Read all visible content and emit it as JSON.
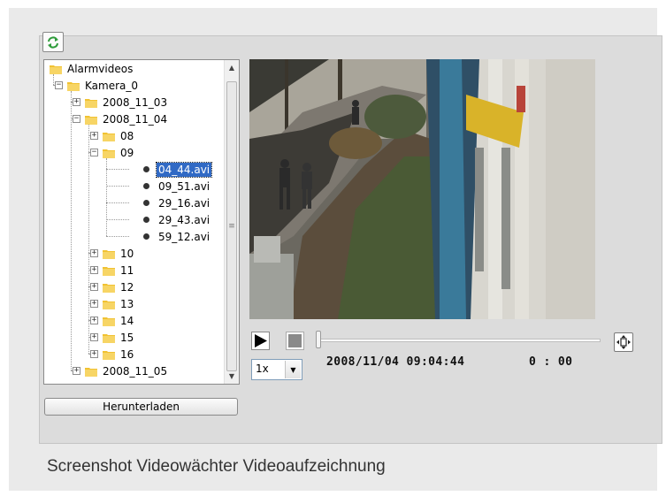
{
  "tree": {
    "items": [
      {
        "label": "Alarmvideos",
        "kind": "folder",
        "level": 0
      },
      {
        "label": "Kamera_0",
        "kind": "folder",
        "level": 1,
        "expanded": true
      },
      {
        "label": "2008_11_03",
        "kind": "folder",
        "level": 2,
        "expanded": false
      },
      {
        "label": "2008_11_04",
        "kind": "folder",
        "level": 2,
        "expanded": true
      },
      {
        "label": "08",
        "kind": "folder",
        "level": 3,
        "expanded": false
      },
      {
        "label": "09",
        "kind": "folder",
        "level": 3,
        "expanded": true
      },
      {
        "label": "04_44.avi",
        "kind": "file",
        "level": 4,
        "selected": true
      },
      {
        "label": "09_51.avi",
        "kind": "file",
        "level": 4
      },
      {
        "label": "29_16.avi",
        "kind": "file",
        "level": 4
      },
      {
        "label": "29_43.avi",
        "kind": "file",
        "level": 4
      },
      {
        "label": "59_12.avi",
        "kind": "file",
        "level": 4
      },
      {
        "label": "10",
        "kind": "folder",
        "level": 3,
        "expanded": false
      },
      {
        "label": "11",
        "kind": "folder",
        "level": 3,
        "expanded": false
      },
      {
        "label": "12",
        "kind": "folder",
        "level": 3,
        "expanded": false
      },
      {
        "label": "13",
        "kind": "folder",
        "level": 3,
        "expanded": false
      },
      {
        "label": "14",
        "kind": "folder",
        "level": 3,
        "expanded": false
      },
      {
        "label": "15",
        "kind": "folder",
        "level": 3,
        "expanded": false
      },
      {
        "label": "16",
        "kind": "folder",
        "level": 3,
        "expanded": false
      },
      {
        "label": "2008_11_05",
        "kind": "folder",
        "level": 2,
        "expanded": false
      }
    ]
  },
  "buttons": {
    "download_label": "Herunterladen"
  },
  "player": {
    "speed": "1x",
    "timestamp": "2008/11/04 09:04:44",
    "elapsed": "0 : 00",
    "progress": 0
  },
  "caption": "Screenshot Videowächter Videoaufzeichnung",
  "icons": {
    "refresh": "refresh-icon",
    "folder": "folder-icon",
    "file": "file-icon",
    "play": "play-icon",
    "stop": "stop-icon",
    "fullscreen": "fullscreen-icon",
    "dropdown": "chevron-down-icon"
  },
  "colors": {
    "selection": "#316ac5",
    "folder": "#f1c232",
    "refresh": "#2e9b3a"
  }
}
